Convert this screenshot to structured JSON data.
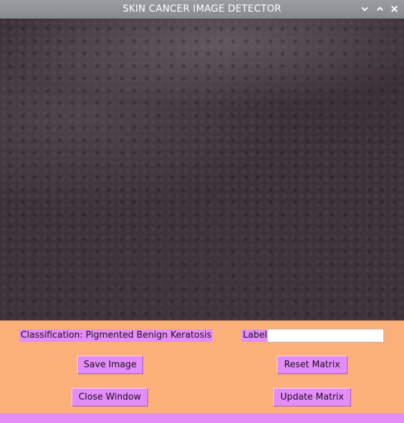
{
  "window": {
    "title": "SKIN CANCER IMAGE DETECTOR",
    "controls": [
      "minimize-icon",
      "maximize-icon",
      "close-icon"
    ]
  },
  "colors": {
    "panel_background": "#fbb07a",
    "widget_accent": "#e38df6",
    "titlebar": "#8f9296"
  },
  "classification": {
    "text": "Classification: Pigmented Benign Keratosis"
  },
  "label_field": {
    "label": "Label",
    "value": "",
    "placeholder": ""
  },
  "buttons": {
    "save_image": "Save Image",
    "reset_matrix": "Reset Matrix",
    "close_window": "Close Window",
    "update_matrix": "Update Matrix"
  }
}
